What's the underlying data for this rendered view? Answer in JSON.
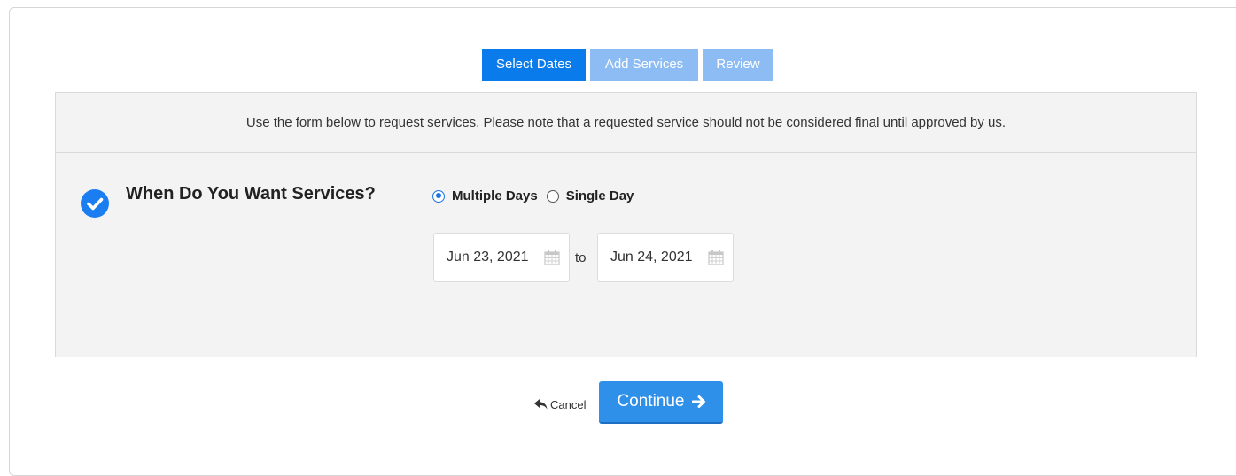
{
  "steps": {
    "select_dates": "Select Dates",
    "add_services": "Add Services",
    "review": "Review"
  },
  "notice": "Use the form below to request services. Please note that a requested service should not be considered final until approved by us.",
  "question": "When Do You Want Services?",
  "schedule_options": {
    "multiple_days": "Multiple Days",
    "single_day": "Single Day",
    "selected": "Multiple Days"
  },
  "dates": {
    "from": "Jun 23, 2021",
    "separator": "to",
    "to": "Jun 24, 2021"
  },
  "footer": {
    "cancel_label": "Cancel",
    "continue_label": "Continue"
  },
  "colors": {
    "active_step": "#0a7bea",
    "inactive_step": "#8cbcf3",
    "primary_button": "#2f90ea",
    "check_badge": "#1a7ef0"
  },
  "icons": [
    "check-circle-icon",
    "calendar-icon",
    "reply-arrow-icon",
    "arrow-right-icon"
  ]
}
